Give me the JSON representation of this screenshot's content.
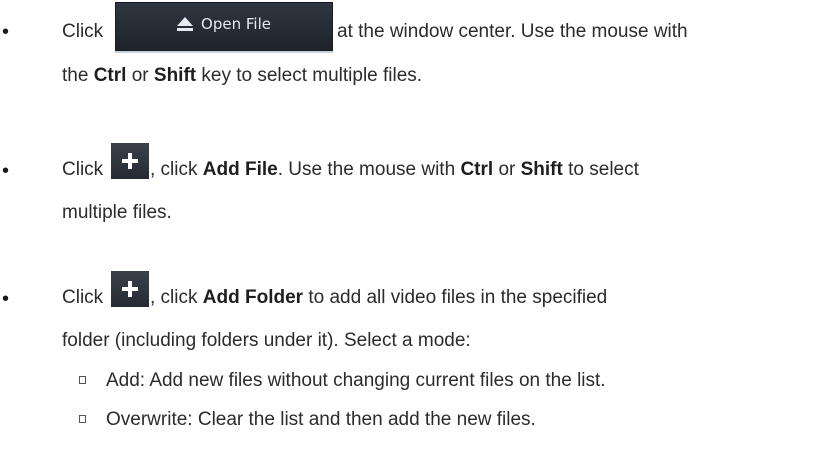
{
  "items": [
    {
      "bullet": "•",
      "click_label": "Click",
      "button_label": "Open File",
      "line1_rest": "at the window center. Use the mouse with",
      "line2": {
        "pre": "the ",
        "ctrl": "Ctrl",
        "mid": " or ",
        "shift": "Shift",
        "post": " key to select multiple files."
      }
    },
    {
      "bullet": "•",
      "click_label": "Click",
      "line1": {
        "comma_click": ", click ",
        "add_file": "Add File",
        "mid1": ". Use the mouse with ",
        "ctrl": "Ctrl",
        "or": " or ",
        "shift": "Shift",
        "end": " to select"
      },
      "line2": "multiple files."
    },
    {
      "bullet": "•",
      "click_label": "Click",
      "line1": {
        "comma_click": ", click ",
        "add_folder": "Add Folder",
        "rest": " to add all video files in the specified"
      },
      "line2": "folder (including folders under it). Select a mode:",
      "modes": [
        "Add: Add new files without changing current files on the list.",
        "Overwrite: Clear the list and then add the new files."
      ]
    }
  ]
}
